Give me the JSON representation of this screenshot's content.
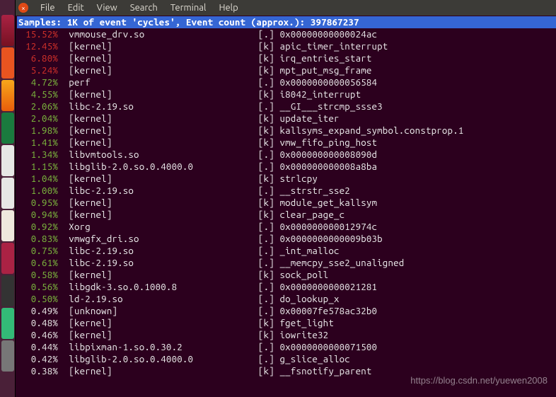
{
  "menubar": {
    "items": [
      "File",
      "Edit",
      "View",
      "Search",
      "Terminal",
      "Help"
    ]
  },
  "header": {
    "text": "Samples: 1K of event 'cycles', Event count (approx.): 397867237"
  },
  "watermark": "https://blog.csdn.net/yuewen2008",
  "launcher_icons": [
    "dash",
    "files",
    "firefox",
    "spreadsheet",
    "document",
    "software",
    "amazon",
    "settings",
    "terminal",
    "mail"
  ],
  "rows": [
    {
      "pct": "15.52%",
      "color": "red",
      "obj": "vmmouse_drv.so",
      "flag": "[.]",
      "sym": "0x00000000000024ac"
    },
    {
      "pct": "12.45%",
      "color": "red",
      "obj": "[kernel]",
      "flag": "[k]",
      "sym": "apic_timer_interrupt"
    },
    {
      "pct": "6.80%",
      "color": "red",
      "obj": "[kernel]",
      "flag": "[k]",
      "sym": "irq_entries_start"
    },
    {
      "pct": "5.24%",
      "color": "red",
      "obj": "[kernel]",
      "flag": "[k]",
      "sym": "mpt_put_msg_frame"
    },
    {
      "pct": "4.72%",
      "color": "green",
      "obj": "perf",
      "flag": "[.]",
      "sym": "0x0000000000056584"
    },
    {
      "pct": "4.55%",
      "color": "green",
      "obj": "[kernel]",
      "flag": "[k]",
      "sym": "i8042_interrupt"
    },
    {
      "pct": "2.06%",
      "color": "green",
      "obj": "libc-2.19.so",
      "flag": "[.]",
      "sym": "__GI___strcmp_ssse3"
    },
    {
      "pct": "2.04%",
      "color": "green",
      "obj": "[kernel]",
      "flag": "[k]",
      "sym": "update_iter"
    },
    {
      "pct": "1.98%",
      "color": "green",
      "obj": "[kernel]",
      "flag": "[k]",
      "sym": "kallsyms_expand_symbol.constprop.1"
    },
    {
      "pct": "1.41%",
      "color": "green",
      "obj": "[kernel]",
      "flag": "[k]",
      "sym": "vmw_fifo_ping_host"
    },
    {
      "pct": "1.34%",
      "color": "green",
      "obj": "libvmtools.so",
      "flag": "[.]",
      "sym": "0x000000000008090d"
    },
    {
      "pct": "1.15%",
      "color": "green",
      "obj": "libglib-2.0.so.0.4000.0",
      "flag": "[.]",
      "sym": "0x000000000008a8ba"
    },
    {
      "pct": "1.04%",
      "color": "green",
      "obj": "[kernel]",
      "flag": "[k]",
      "sym": "strlcpy"
    },
    {
      "pct": "1.00%",
      "color": "green",
      "obj": "libc-2.19.so",
      "flag": "[.]",
      "sym": "__strstr_sse2"
    },
    {
      "pct": "0.95%",
      "color": "green",
      "obj": "[kernel]",
      "flag": "[k]",
      "sym": "module_get_kallsym"
    },
    {
      "pct": "0.94%",
      "color": "green",
      "obj": "[kernel]",
      "flag": "[k]",
      "sym": "clear_page_c"
    },
    {
      "pct": "0.92%",
      "color": "green",
      "obj": "Xorg",
      "flag": "[.]",
      "sym": "0x000000000012974c"
    },
    {
      "pct": "0.83%",
      "color": "green",
      "obj": "vmwgfx_dri.so",
      "flag": "[.]",
      "sym": "0x0000000000009b03b"
    },
    {
      "pct": "0.75%",
      "color": "green",
      "obj": "libc-2.19.so",
      "flag": "[.]",
      "sym": "_int_malloc"
    },
    {
      "pct": "0.61%",
      "color": "green",
      "obj": "libc-2.19.so",
      "flag": "[.]",
      "sym": "__memcpy_sse2_unaligned"
    },
    {
      "pct": "0.58%",
      "color": "green",
      "obj": "[kernel]",
      "flag": "[k]",
      "sym": "sock_poll"
    },
    {
      "pct": "0.56%",
      "color": "green",
      "obj": "libgdk-3.so.0.1000.8",
      "flag": "[.]",
      "sym": "0x0000000000021281"
    },
    {
      "pct": "0.50%",
      "color": "green",
      "obj": "ld-2.19.so",
      "flag": "[.]",
      "sym": "do_lookup_x"
    },
    {
      "pct": "0.49%",
      "color": "white",
      "obj": "[unknown]",
      "flag": "[.]",
      "sym": "0x00007fe578ac32b0"
    },
    {
      "pct": "0.48%",
      "color": "white",
      "obj": "[kernel]",
      "flag": "[k]",
      "sym": "fget_light"
    },
    {
      "pct": "0.46%",
      "color": "white",
      "obj": "[kernel]",
      "flag": "[k]",
      "sym": "iowrite32"
    },
    {
      "pct": "0.44%",
      "color": "white",
      "obj": "libpixman-1.so.0.30.2",
      "flag": "[.]",
      "sym": "0x0000000000071500"
    },
    {
      "pct": "0.42%",
      "color": "white",
      "obj": "libglib-2.0.so.0.4000.0",
      "flag": "[.]",
      "sym": "g_slice_alloc"
    },
    {
      "pct": "0.38%",
      "color": "white",
      "obj": "[kernel]",
      "flag": "[k]",
      "sym": "__fsnotify_parent"
    }
  ]
}
